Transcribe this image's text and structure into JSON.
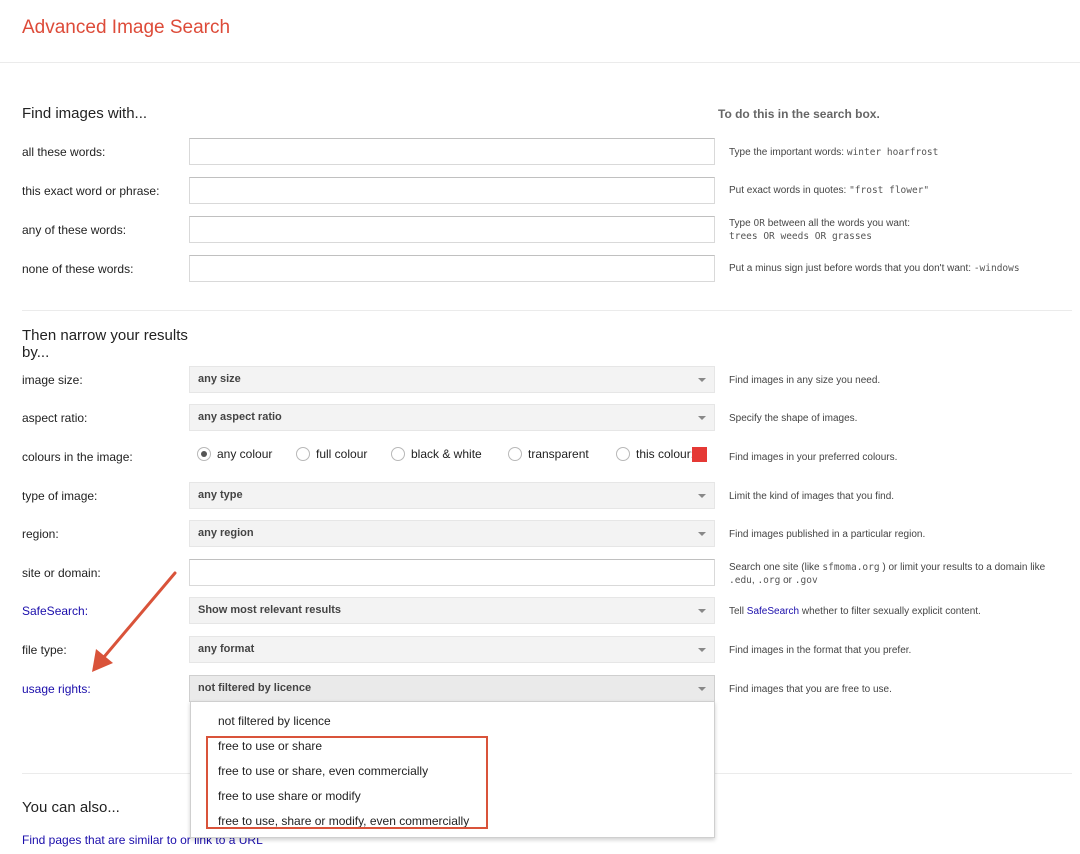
{
  "page": {
    "title": "Advanced Image Search"
  },
  "find": {
    "heading": "Find images with...",
    "hint_header": "To do this in the search box.",
    "rows": [
      {
        "label": "all these words:",
        "value": "",
        "hint_prefix": "Type the important words: ",
        "hint_code": "winter hoarfrost"
      },
      {
        "label": "this exact word or phrase:",
        "value": "",
        "hint_prefix": "Put exact words in quotes: ",
        "hint_code": "\"frost flower\""
      },
      {
        "label": "any of these words:",
        "value": "",
        "hint_line1_a": "Type ",
        "hint_line1_or": "OR",
        "hint_line1_b": " between all the words you want:",
        "hint_code": "trees OR weeds OR grasses"
      },
      {
        "label": "none of these words:",
        "value": "",
        "hint_prefix": "Put a minus sign just before words that you don't want: ",
        "hint_code": "-windows"
      }
    ]
  },
  "narrow": {
    "heading_line1": "Then narrow your results",
    "heading_line2": "by...",
    "image_size": {
      "label": "image size:",
      "selected": "any size",
      "hint": "Find images in any size you need."
    },
    "aspect_ratio": {
      "label": "aspect ratio:",
      "selected": "any aspect ratio",
      "hint": "Specify the shape of images."
    },
    "colours": {
      "label": "colours in the image:",
      "options": [
        "any colour",
        "full colour",
        "black & white",
        "transparent",
        "this colour:"
      ],
      "selected_index": 0,
      "swatch_color": "#e53935",
      "hint": "Find images in your preferred colours."
    },
    "type_of_image": {
      "label": "type of image:",
      "selected": "any type",
      "hint": "Limit the kind of images that you find."
    },
    "region": {
      "label": "region:",
      "selected": "any region",
      "hint": "Find images published in a particular region."
    },
    "site": {
      "label": "site or domain:",
      "value": "",
      "hint_a": "Search one site (like ",
      "hint_code1": "sfmoma.org",
      "hint_b": " ) or limit your results to a domain like",
      "hint_code2": ".edu",
      "hint_c": ", ",
      "hint_code3": ".org",
      "hint_d": " or ",
      "hint_code4": ".gov"
    },
    "safesearch": {
      "label": "SafeSearch:",
      "selected": "Show most relevant results",
      "hint_a": "Tell ",
      "hint_link": "SafeSearch",
      "hint_b": " whether to filter sexually explicit content."
    },
    "file_type": {
      "label": "file type:",
      "selected": "any format",
      "hint": "Find images in the format that you prefer."
    },
    "usage_rights": {
      "label": "usage rights:",
      "selected": "not filtered by licence",
      "hint": "Find images that you are free to use.",
      "options": [
        "not filtered by licence",
        "free to use or share",
        "free to use or share, even commercially",
        "free to use share or modify",
        "free to use, share or modify, even commercially"
      ]
    }
  },
  "also": {
    "heading": "You can also...",
    "links": [
      "Find pages that are similar to or link to a URL"
    ]
  },
  "colors": {
    "accent_title": "#dd4b39",
    "link": "#1a0dab",
    "annotation": "#d9533a"
  }
}
